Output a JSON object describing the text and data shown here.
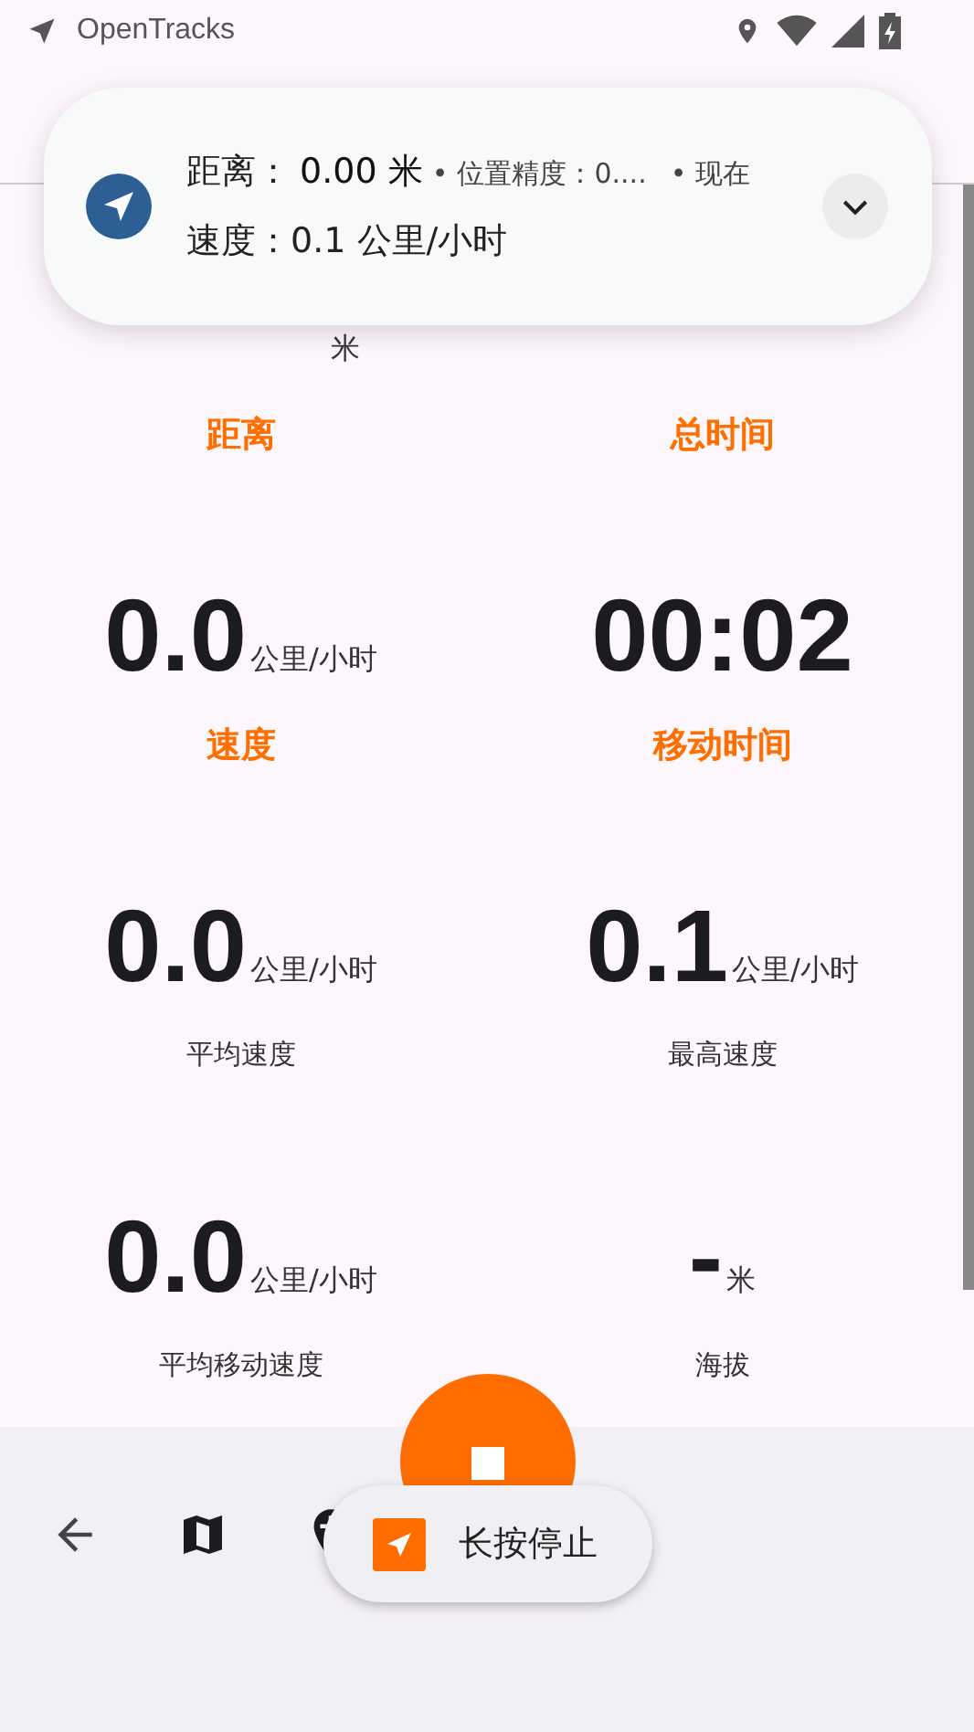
{
  "status_bar": {
    "app_name": "OpenTracks"
  },
  "notification": {
    "line_1_label": "距离：",
    "line_1_value": "0.00 米",
    "separator_1": "•",
    "accuracy": "位置精度：0....",
    "separator_2": "•",
    "time": "现在",
    "line_2": "速度：0.1 公里/小时",
    "expanded": false
  },
  "stats": [
    {
      "unit": "米",
      "label": "距离",
      "highlighted": true
    },
    {
      "label": "总时间",
      "highlighted": true
    },
    {
      "value": "0.0",
      "unit": "公里/小时",
      "label": "速度",
      "highlighted": true
    },
    {
      "value": "00:02",
      "label": "移动时间",
      "highlighted": true
    },
    {
      "value": "0.0",
      "unit": "公里/小时",
      "label": "平均速度",
      "highlighted": false
    },
    {
      "value": "0.1",
      "unit": "公里/小时",
      "label": "最高速度",
      "highlighted": false
    },
    {
      "value": "0.0",
      "unit": "公里/小时",
      "label": "平均移动速度",
      "highlighted": false
    },
    {
      "value": "-",
      "unit": "米",
      "label": "海拔",
      "highlighted": false
    }
  ],
  "toast": {
    "text": "长按停止"
  }
}
